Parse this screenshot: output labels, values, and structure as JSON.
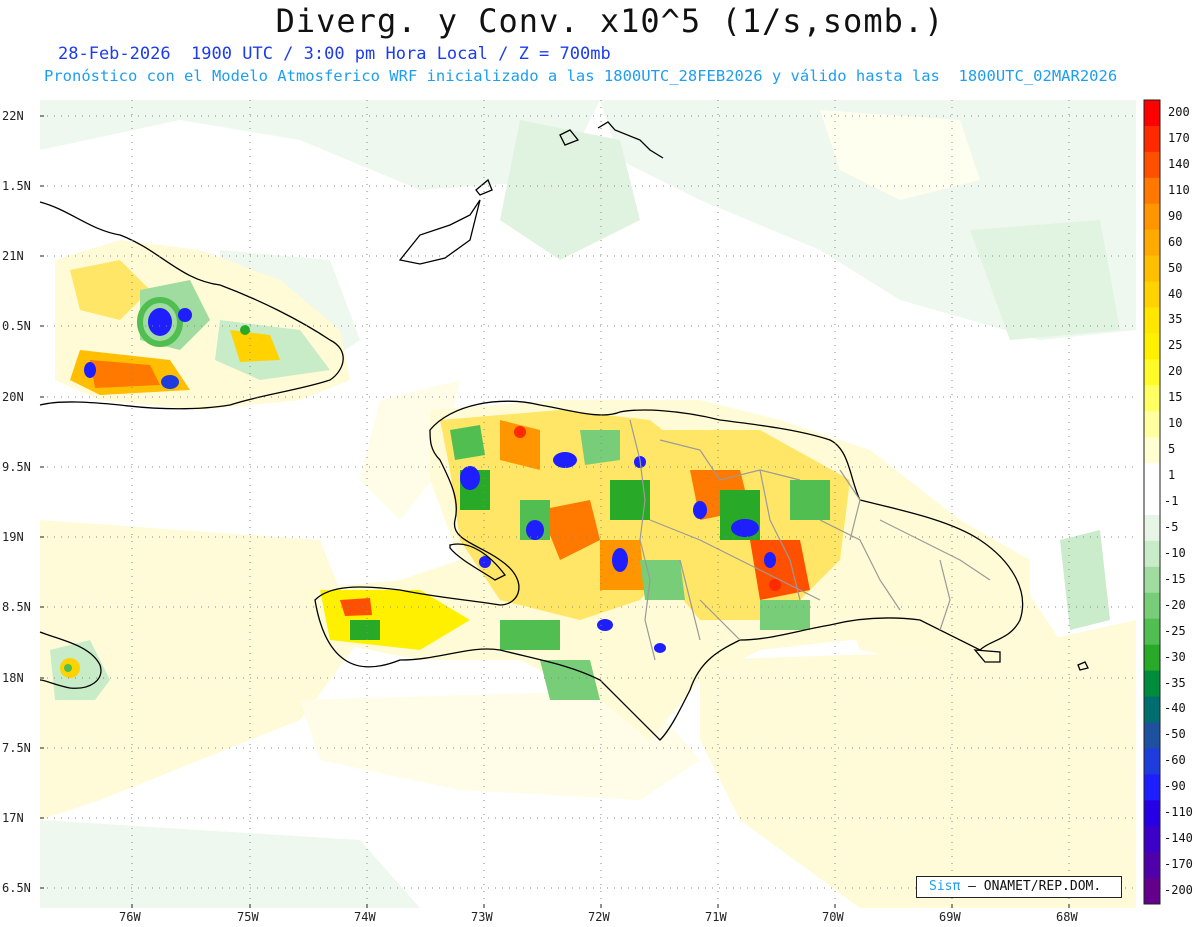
{
  "header": {
    "title": "Diverg. y Conv. x10^5 (1/s,somb.)",
    "subtitle_line1": "28-Feb-2026  1900 UTC / 3:00 pm Hora Local / Z = 700mb",
    "subtitle_line2": "Pronóstico con el Modelo Atmosferico WRF inicializado a las 1800UTC_28FEB2026 y válido hasta las  1800UTC_02MAR2026"
  },
  "map": {
    "lat_labels": [
      "22N",
      "1.5N",
      "21N",
      "0.5N",
      "20N",
      "9.5N",
      "19N",
      "8.5N",
      "18N",
      "7.5N",
      "17N",
      "6.5N"
    ],
    "lon_labels": [
      "76W",
      "75W",
      "74W",
      "73W",
      "72W",
      "71W",
      "70W",
      "69W",
      "68W"
    ],
    "grid": "dotted"
  },
  "colorbar": {
    "labels": [
      "200",
      "170",
      "140",
      "110",
      "90",
      "60",
      "50",
      "40",
      "35",
      "25",
      "20",
      "15",
      "10",
      "5",
      "1",
      "-1",
      "-5",
      "-10",
      "-15",
      "-20",
      "-25",
      "-30",
      "-35",
      "-40",
      "-50",
      "-60",
      "-90",
      "-110",
      "-140",
      "-170",
      "-200"
    ],
    "colors": [
      "#ff0000",
      "#ff2a00",
      "#ff5000",
      "#ff7800",
      "#ff9600",
      "#ffaa00",
      "#ffbe00",
      "#ffd200",
      "#ffe600",
      "#fff000",
      "#fffa28",
      "#ffff64",
      "#ffffa0",
      "#ffffd2",
      "#ffffff",
      "#ffffff",
      "#e6f5e6",
      "#c8ebc8",
      "#a0dca0",
      "#78cd78",
      "#50be50",
      "#28aa28",
      "#008c3c",
      "#006e6e",
      "#1e50a0",
      "#1e3cdc",
      "#1e1eff",
      "#2800e6",
      "#3c00c8",
      "#5000aa",
      "#64008c"
    ]
  },
  "credit": {
    "logo": "Sisπ",
    "org": "– ONAMET/REP.DOM."
  }
}
